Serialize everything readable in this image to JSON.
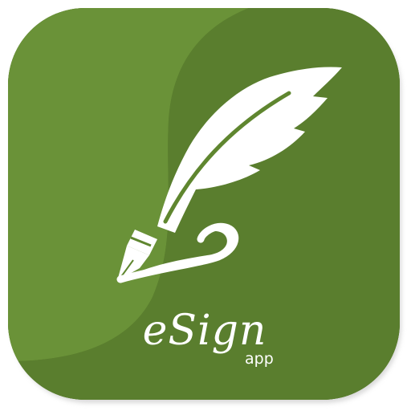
{
  "app": {
    "name": "eSign",
    "suffix": "app"
  },
  "icon": {
    "name": "quill-pen-icon"
  },
  "colors": {
    "tile_base": "#5a7e2e",
    "tile_highlight": "#6a9238",
    "tile_shadow_band": "#4f7226",
    "foreground": "#ffffff"
  }
}
